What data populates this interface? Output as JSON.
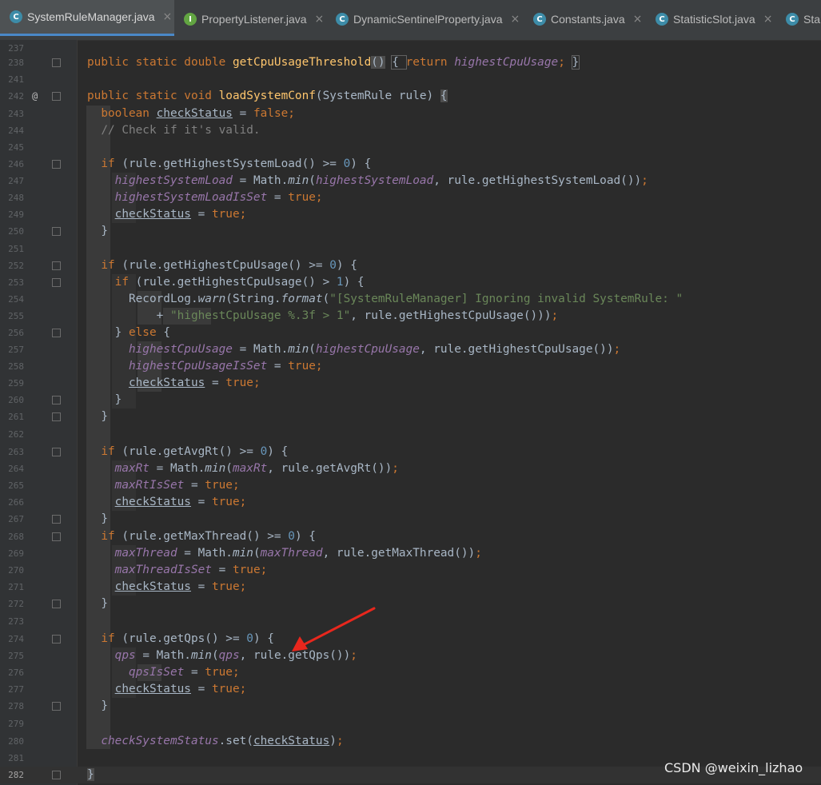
{
  "editor": {
    "tabs": [
      {
        "label": "SystemRuleManager.java",
        "icon": "class-c-icon",
        "close": "×",
        "active": true
      },
      {
        "label": "PropertyListener.java",
        "icon": "interface-i-icon",
        "close": "×"
      },
      {
        "label": "DynamicSentinelProperty.java",
        "icon": "class-c-icon",
        "close": "×"
      },
      {
        "label": "Constants.java",
        "icon": "class-c-icon",
        "close": "×"
      },
      {
        "label": "StatisticSlot.java",
        "icon": "class-c-icon",
        "close": "×"
      },
      {
        "label": "Sta",
        "icon": "class-c-icon"
      }
    ],
    "icon_letters": {
      "class": "C",
      "interface": "I"
    },
    "gutter_annotation": "@",
    "lines": [
      {
        "n": "237"
      },
      {
        "n": "238",
        "code": "public static double getCpuUsageThreshold() { return highestCpuUsage; }"
      },
      {
        "n": "241"
      },
      {
        "n": "242",
        "code": "public static void loadSystemConf(SystemRule rule) {"
      },
      {
        "n": "243",
        "code": "boolean checkStatus = false;"
      },
      {
        "n": "244",
        "code": "// Check if it's valid."
      },
      {
        "n": "245"
      },
      {
        "n": "246",
        "code": "if (rule.getHighestSystemLoad() >= 0) {"
      },
      {
        "n": "247",
        "code": "highestSystemLoad = Math.min(highestSystemLoad, rule.getHighestSystemLoad());"
      },
      {
        "n": "248",
        "code": "highestSystemLoadIsSet = true;"
      },
      {
        "n": "249",
        "code": "checkStatus = true;"
      },
      {
        "n": "250",
        "code": "}"
      },
      {
        "n": "251"
      },
      {
        "n": "252",
        "code": "if (rule.getHighestCpuUsage() >= 0) {"
      },
      {
        "n": "253",
        "code": "if (rule.getHighestCpuUsage() > 1) {"
      },
      {
        "n": "254",
        "code": "RecordLog.warn(String.format(\"[SystemRuleManager] Ignoring invalid SystemRule: \""
      },
      {
        "n": "255",
        "code": "+ \"highestCpuUsage %.3f > 1\", rule.getHighestCpuUsage()));"
      },
      {
        "n": "256",
        "code": "} else {"
      },
      {
        "n": "257",
        "code": "highestCpuUsage = Math.min(highestCpuUsage, rule.getHighestCpuUsage());"
      },
      {
        "n": "258",
        "code": "highestCpuUsageIsSet = true;"
      },
      {
        "n": "259",
        "code": "checkStatus = true;"
      },
      {
        "n": "260",
        "code": "}"
      },
      {
        "n": "261",
        "code": "}"
      },
      {
        "n": "262"
      },
      {
        "n": "263",
        "code": "if (rule.getAvgRt() >= 0) {"
      },
      {
        "n": "264",
        "code": "maxRt = Math.min(maxRt, rule.getAvgRt());"
      },
      {
        "n": "265",
        "code": "maxRtIsSet = true;"
      },
      {
        "n": "266",
        "code": "checkStatus = true;"
      },
      {
        "n": "267",
        "code": "}"
      },
      {
        "n": "268",
        "code": "if (rule.getMaxThread() >= 0) {"
      },
      {
        "n": "269",
        "code": "maxThread = Math.min(maxThread, rule.getMaxThread());"
      },
      {
        "n": "270",
        "code": "maxThreadIsSet = true;"
      },
      {
        "n": "271",
        "code": "checkStatus = true;"
      },
      {
        "n": "272",
        "code": "}"
      },
      {
        "n": "273"
      },
      {
        "n": "274",
        "code": "if (rule.getQps() >= 0) {"
      },
      {
        "n": "275",
        "code": "qps = Math.min(qps, rule.getQps());"
      },
      {
        "n": "276",
        "code": "qpsIsSet = true;"
      },
      {
        "n": "277",
        "code": "checkStatus = true;"
      },
      {
        "n": "278",
        "code": "}"
      },
      {
        "n": "279"
      },
      {
        "n": "280",
        "code": "checkSystemStatus.set(checkStatus);"
      },
      {
        "n": "281"
      },
      {
        "n": "282",
        "code": "}"
      }
    ]
  },
  "overlay": {
    "annotation_arrow": "red-arrow-icon",
    "watermark": "CSDN @weixin_lizhao",
    "arrow_color": "#e8271d"
  },
  "colors": {
    "background": "#2b2b2b",
    "keyword": "#cc7832",
    "number": "#6897bb",
    "string": "#6a8759",
    "field": "#9876aa",
    "method": "#ffc66d",
    "comment": "#808080",
    "text": "#a9b7c6",
    "tab_accent": "#4a88c7"
  }
}
